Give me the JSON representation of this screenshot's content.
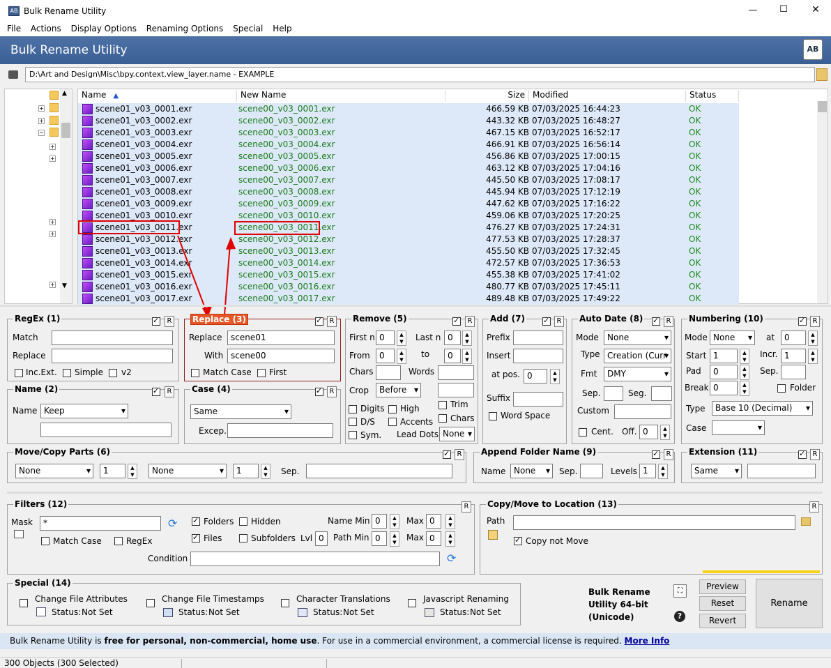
{
  "window": {
    "title": "Bulk Rename Utility",
    "controls": [
      "—",
      "☐",
      "✕"
    ]
  },
  "menu": [
    "File",
    "Actions",
    "Display Options",
    "Renaming Options",
    "Special",
    "Help"
  ],
  "banner": {
    "title": "Bulk Rename Utility"
  },
  "path": {
    "value": "D:\\Art and Design\\Misc\\bpy.context.view_layer.name - EXAMPLE"
  },
  "columns": {
    "name": "Name",
    "new_name": "New Name",
    "size": "Size",
    "modified": "Modified",
    "status": "Status"
  },
  "files": [
    {
      "name": "scene01_v03_0001.exr",
      "new": "scene00_v03_0001.exr",
      "size": "466.59 KB",
      "modified": "07/03/2025 16:44:23",
      "status": "OK"
    },
    {
      "name": "scene01_v03_0002.exr",
      "new": "scene00_v03_0002.exr",
      "size": "443.32 KB",
      "modified": "07/03/2025 16:48:27",
      "status": "OK"
    },
    {
      "name": "scene01_v03_0003.exr",
      "new": "scene00_v03_0003.exr",
      "size": "467.15 KB",
      "modified": "07/03/2025 16:52:17",
      "status": "OK"
    },
    {
      "name": "scene01_v03_0004.exr",
      "new": "scene00_v03_0004.exr",
      "size": "466.91 KB",
      "modified": "07/03/2025 16:56:14",
      "status": "OK"
    },
    {
      "name": "scene01_v03_0005.exr",
      "new": "scene00_v03_0005.exr",
      "size": "456.86 KB",
      "modified": "07/03/2025 17:00:15",
      "status": "OK"
    },
    {
      "name": "scene01_v03_0006.exr",
      "new": "scene00_v03_0006.exr",
      "size": "463.12 KB",
      "modified": "07/03/2025 17:04:16",
      "status": "OK"
    },
    {
      "name": "scene01_v03_0007.exr",
      "new": "scene00_v03_0007.exr",
      "size": "445.50 KB",
      "modified": "07/03/2025 17:08:17",
      "status": "OK"
    },
    {
      "name": "scene01_v03_0008.exr",
      "new": "scene00_v03_0008.exr",
      "size": "445.94 KB",
      "modified": "07/03/2025 17:12:19",
      "status": "OK"
    },
    {
      "name": "scene01_v03_0009.exr",
      "new": "scene00_v03_0009.exr",
      "size": "447.62 KB",
      "modified": "07/03/2025 17:16:22",
      "status": "OK"
    },
    {
      "name": "scene01_v03_0010.exr",
      "new": "scene00_v03_0010.exr",
      "size": "459.06 KB",
      "modified": "07/03/2025 17:20:25",
      "status": "OK"
    },
    {
      "name": "scene01_v03_0011.exr",
      "new": "scene00_v03_0011.exr",
      "size": "476.27 KB",
      "modified": "07/03/2025 17:24:31",
      "status": "OK"
    },
    {
      "name": "scene01_v03_0012.exr",
      "new": "scene00_v03_0012.exr",
      "size": "477.53 KB",
      "modified": "07/03/2025 17:28:37",
      "status": "OK"
    },
    {
      "name": "scene01_v03_0013.exr",
      "new": "scene00_v03_0013.exr",
      "size": "455.50 KB",
      "modified": "07/03/2025 17:32:45",
      "status": "OK"
    },
    {
      "name": "scene01_v03_0014.exr",
      "new": "scene00_v03_0014.exr",
      "size": "472.57 KB",
      "modified": "07/03/2025 17:36:53",
      "status": "OK"
    },
    {
      "name": "scene01_v03_0015.exr",
      "new": "scene00_v03_0015.exr",
      "size": "455.38 KB",
      "modified": "07/03/2025 17:41:02",
      "status": "OK"
    },
    {
      "name": "scene01_v03_0016.exr",
      "new": "scene00_v03_0016.exr",
      "size": "480.77 KB",
      "modified": "07/03/2025 17:45:11",
      "status": "OK"
    },
    {
      "name": "scene01_v03_0017.exr",
      "new": "scene00_v03_0017.exr",
      "size": "489.48 KB",
      "modified": "07/03/2025 17:49:22",
      "status": "OK"
    }
  ],
  "regex": {
    "title": "RegEx (1)",
    "match_label": "Match",
    "replace_label": "Replace",
    "incext": "Inc.Ext.",
    "simple": "Simple",
    "v2": "v2"
  },
  "replace": {
    "title": "Replace (3)",
    "replace_label": "Replace",
    "replace_value": "scene01",
    "with_label": "With",
    "with_value": "scene00",
    "match_case": "Match Case",
    "first": "First"
  },
  "remove": {
    "title": "Remove (5)",
    "first_n": "First n",
    "first_n_val": "0",
    "last_n": "Last n",
    "last_n_val": "0",
    "from": "From",
    "from_val": "0",
    "to": "to",
    "to_val": "0",
    "chars": "Chars",
    "words": "Words",
    "crop": "Crop",
    "crop_val": "Before",
    "digits": "Digits",
    "high": "High",
    "trim": "Trim",
    "ds": "D/S",
    "accents": "Accents",
    "chars2": "Chars",
    "sym": "Sym.",
    "lead_dots": "Lead Dots",
    "lead_val": "None"
  },
  "add": {
    "title": "Add (7)",
    "prefix": "Prefix",
    "insert": "Insert",
    "at_pos": "at pos.",
    "at_pos_val": "0",
    "suffix": "Suffix",
    "word_space": "Word Space"
  },
  "autodate": {
    "title": "Auto Date (8)",
    "mode": "Mode",
    "mode_val": "None",
    "type": "Type",
    "type_val": "Creation (Curr",
    "fmt": "Fmt",
    "fmt_val": "DMY",
    "sep": "Sep.",
    "seg": "Seg.",
    "custom": "Custom",
    "cent": "Cent.",
    "off": "Off.",
    "off_val": "0"
  },
  "numbering": {
    "title": "Numbering (10)",
    "mode": "Mode",
    "mode_val": "None",
    "at": "at",
    "at_val": "0",
    "start": "Start",
    "start_val": "1",
    "incr": "Incr.",
    "incr_val": "1",
    "pad": "Pad",
    "pad_val": "0",
    "sep": "Sep.",
    "brk": "Break",
    "brk_val": "0",
    "folder": "Folder",
    "type": "Type",
    "type_val": "Base 10 (Decimal)",
    "case": "Case"
  },
  "name": {
    "title": "Name (2)",
    "name_label": "Name",
    "name_val": "Keep"
  },
  "case": {
    "title": "Case (4)",
    "case_val": "Same",
    "excep": "Excep."
  },
  "movecopy": {
    "title": "Move/Copy Parts (6)",
    "sel1": "None",
    "num1": "1",
    "sel2": "None",
    "num2": "1",
    "sep": "Sep."
  },
  "appendfolder": {
    "title": "Append Folder Name (9)",
    "name": "Name",
    "name_val": "None",
    "sep": "Sep.",
    "levels": "Levels",
    "levels_val": "1"
  },
  "extension": {
    "title": "Extension (11)",
    "val": "Same"
  },
  "filters": {
    "title": "Filters (12)",
    "mask": "Mask",
    "mask_val": "*",
    "folders": "Folders",
    "hidden": "Hidden",
    "name_min": "Name Min",
    "name_min_val": "0",
    "max": "Max",
    "max_val": "0",
    "match_case": "Match Case",
    "regex": "RegEx",
    "files": "Files",
    "subfolders": "Subfolders",
    "lvl": "Lvl",
    "lvl_val": "0",
    "path_min": "Path Min",
    "path_min_val": "0",
    "max2": "Max",
    "max2_val": "0",
    "condition": "Condition"
  },
  "copymove": {
    "title": "Copy/Move to Location (13)",
    "path": "Path",
    "copy_not_move": "Copy not Move"
  },
  "special": {
    "title": "Special (14)",
    "attrs": "Change File Attributes",
    "timestamps": "Change File Timestamps",
    "translations": "Character Translations",
    "javascript": "Javascript Renaming",
    "status_label": "Status:",
    "status_val": "Not Set"
  },
  "product": {
    "line1": "Bulk Rename",
    "line2": "Utility 64-bit",
    "line3": "(Unicode)"
  },
  "buttons": {
    "preview": "Preview",
    "reset": "Reset",
    "revert": "Revert",
    "rename": "Rename",
    "r": "R"
  },
  "info": {
    "prefix": "Bulk Rename Utility is ",
    "bold": "free for personal, non-commercial, home use",
    "rest": ". For use in a commercial environment, a commercial license is required. ",
    "link": "More Info"
  },
  "statusbar": {
    "objects": "300 Objects (300 Selected)"
  },
  "colors": {
    "new_name": "#1a7a1a",
    "ok": "#1a8a1a",
    "highlight": "#e00000",
    "banner": "#4a6ea3"
  }
}
